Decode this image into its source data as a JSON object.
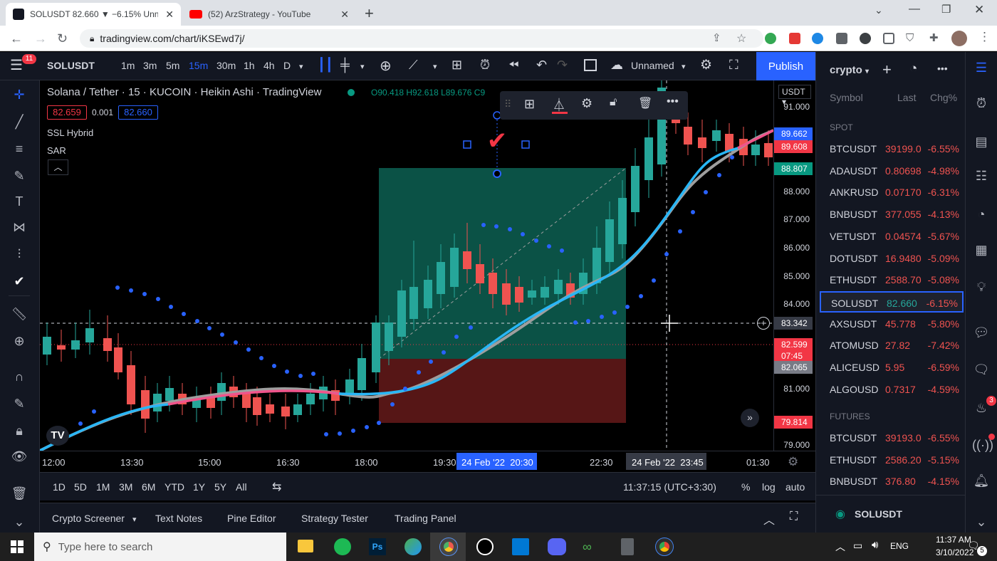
{
  "browser": {
    "tabs": [
      {
        "title": "SOLUSDT 82.660 ▼ −6.15% Unna",
        "active": true
      },
      {
        "title": "(52) ArzStrategy - YouTube",
        "active": false
      }
    ],
    "url": "tradingview.com/chart/iKSEwd7j/"
  },
  "toolbar": {
    "symbol": "SOLUSDT",
    "intervals": [
      "1m",
      "3m",
      "5m",
      "15m",
      "30m",
      "1h",
      "4h",
      "D"
    ],
    "active_interval": "15m",
    "layout_name": "Unnamed",
    "publish_label": "Publish",
    "notification_badge": "11"
  },
  "legend": {
    "title": "Solana / Tether · 15 · KUCOIN · Heikin Ashi · TradingView",
    "ohlc": "O90.418  H92.618  L89.676  C9",
    "bid": "82.659",
    "spread": "0.001",
    "ask": "82.660",
    "indicators": [
      "SSL Hybrid",
      "SAR"
    ]
  },
  "price_axis": {
    "currency": "USDT",
    "ticks": [
      "91.000",
      "88.000",
      "87.000",
      "86.000",
      "85.000",
      "84.000",
      "81.000",
      "79.000"
    ],
    "labels": [
      {
        "text": "89.662",
        "color": "#2962ff"
      },
      {
        "text": "89.608",
        "color": "#f23645"
      },
      {
        "text": "88.807",
        "color": "#089981"
      },
      {
        "text": "83.342",
        "color": "#363a45"
      },
      {
        "text": "82.599",
        "color": "#f23645"
      },
      {
        "text": "07:45",
        "color": "#f23645"
      },
      {
        "text": "82.065",
        "color": "#787b86"
      },
      {
        "text": "79.814",
        "color": "#f23645"
      }
    ]
  },
  "time_axis": {
    "ticks": [
      "12:00",
      "13:30",
      "15:00",
      "16:30",
      "18:00",
      "19:30",
      "22:30",
      "01:30"
    ],
    "highlight_1": "24 Feb '22  20:30",
    "highlight_2": "24 Feb '22  23:45"
  },
  "range_bar": {
    "ranges": [
      "1D",
      "5D",
      "1M",
      "3M",
      "6M",
      "YTD",
      "1Y",
      "5Y",
      "All"
    ],
    "clock": "11:37:15 (UTC+3:30)",
    "percent": "%",
    "log": "log",
    "auto": "auto"
  },
  "bottom_tabs": [
    "Crypto Screener",
    "Text Notes",
    "Pine Editor",
    "Strategy Tester",
    "Trading Panel"
  ],
  "watchlist": {
    "title": "crypto",
    "headers": {
      "symbol": "Symbol",
      "last": "Last",
      "chg": "Chg%"
    },
    "spot_label": "SPOT",
    "spot": [
      {
        "symbol": "BTCUSDT",
        "last": "39199.0",
        "chg": "-6.55%"
      },
      {
        "symbol": "ADAUSDT",
        "last": "0.80698",
        "chg": "-4.98%"
      },
      {
        "symbol": "ANKRUSD",
        "last": "0.07170",
        "chg": "-6.31%"
      },
      {
        "symbol": "BNBUSDT",
        "last": "377.055",
        "chg": "-4.13%"
      },
      {
        "symbol": "VETUSDT",
        "last": "0.04574",
        "chg": "-5.67%"
      },
      {
        "symbol": "DOTUSDT",
        "last": "16.9480",
        "chg": "-5.09%"
      },
      {
        "symbol": "ETHUSDT",
        "last": "2588.70",
        "chg": "-5.08%"
      },
      {
        "symbol": "SOLUSDT",
        "last": "82.660",
        "chg": "-6.15%"
      },
      {
        "symbol": "AXSUSDT",
        "last": "45.778",
        "chg": "-5.80%"
      },
      {
        "symbol": "ATOMUSD",
        "last": "27.82",
        "chg": "-7.42%"
      },
      {
        "symbol": "ALICEUSD",
        "last": "5.95",
        "chg": "-6.59%"
      },
      {
        "symbol": "ALGOUSD",
        "last": "0.7317",
        "chg": "-4.59%"
      }
    ],
    "futures_label": "FUTURES",
    "futures": [
      {
        "symbol": "BTCUSDT",
        "last": "39193.0",
        "chg": "-6.55%"
      },
      {
        "symbol": "ETHUSDT",
        "last": "2586.20",
        "chg": "-5.15%"
      },
      {
        "symbol": "BNBUSDT",
        "last": "376.80",
        "chg": "-4.15%"
      }
    ],
    "footer_symbol": "SOLUSDT",
    "badge": "3"
  },
  "taskbar": {
    "search_placeholder": "Type here to search",
    "lang": "ENG",
    "time": "11:37 AM",
    "date": "3/10/2022",
    "notif": "5"
  },
  "colors": {
    "up": "#26a69a",
    "down": "#ef5350",
    "accent": "#2962ff",
    "sar": "#2962ff",
    "ssl": "#29b6f6"
  }
}
